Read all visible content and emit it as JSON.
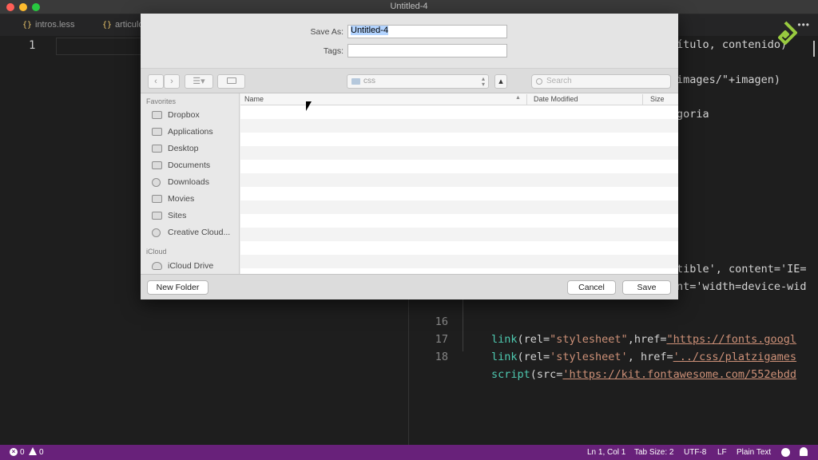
{
  "window": {
    "title": "Untitled-4"
  },
  "tabs": [
    {
      "label": "intros.less"
    },
    {
      "label": "articulo"
    }
  ],
  "editor_left": {
    "line_number": "1"
  },
  "editor_right": {
    "top_fragments": [
      {
        "text": "ítulo, contenido)"
      },
      {
        "text": "images/\"+imagen)"
      },
      {
        "text": "goria"
      }
    ],
    "mid_fragments": [
      {
        "text": "tible', content='IE="
      },
      {
        "text": "nt='width=device-wid"
      }
    ],
    "lines": [
      {
        "num": "16",
        "fn": "link",
        "p1": "(rel=",
        "s1": "\"stylesheet\"",
        "p2": ",href=",
        "s2": "\"https://fonts.googl"
      },
      {
        "num": "17",
        "fn": "link",
        "p1": "(rel=",
        "s1": "'stylesheet'",
        "p2": ", href=",
        "s2": "'../css/platzigames"
      },
      {
        "num": "18",
        "fn": "script",
        "p1": "(src=",
        "s1": "'https://kit.fontawesome.com/552ebdd",
        "p2": "",
        "s2": ""
      }
    ]
  },
  "dialog": {
    "save_as_label": "Save As:",
    "save_as_value": "Untitled-4",
    "tags_label": "Tags:",
    "tags_value": "",
    "location": "css",
    "search_placeholder": "Search",
    "sidebar": {
      "favorites_heading": "Favorites",
      "favorites": [
        {
          "label": "Dropbox",
          "icon": "folder-icon"
        },
        {
          "label": "Applications",
          "icon": "applications-icon"
        },
        {
          "label": "Desktop",
          "icon": "desktop-icon"
        },
        {
          "label": "Documents",
          "icon": "documents-icon"
        },
        {
          "label": "Downloads",
          "icon": "downloads-icon"
        },
        {
          "label": "Movies",
          "icon": "movies-icon"
        },
        {
          "label": "Sites",
          "icon": "sites-icon"
        },
        {
          "label": "Creative Cloud...",
          "icon": "creative-cloud-icon"
        }
      ],
      "icloud_heading": "iCloud",
      "icloud": [
        {
          "label": "iCloud Drive",
          "icon": "cloud-icon"
        }
      ]
    },
    "columns": {
      "name": "Name",
      "date_modified": "Date Modified",
      "size": "Size"
    },
    "new_folder_label": "New Folder",
    "cancel_label": "Cancel",
    "save_label": "Save"
  },
  "status": {
    "errors": "0",
    "warnings": "0",
    "position": "Ln 1, Col 1",
    "tab_size": "Tab Size: 2",
    "encoding": "UTF-8",
    "eol": "LF",
    "language": "Plain Text"
  },
  "colors": {
    "statusbar": "#68217a",
    "editor_bg": "#1e1e1e",
    "function": "#4ec9b0",
    "string": "#ce9178"
  }
}
